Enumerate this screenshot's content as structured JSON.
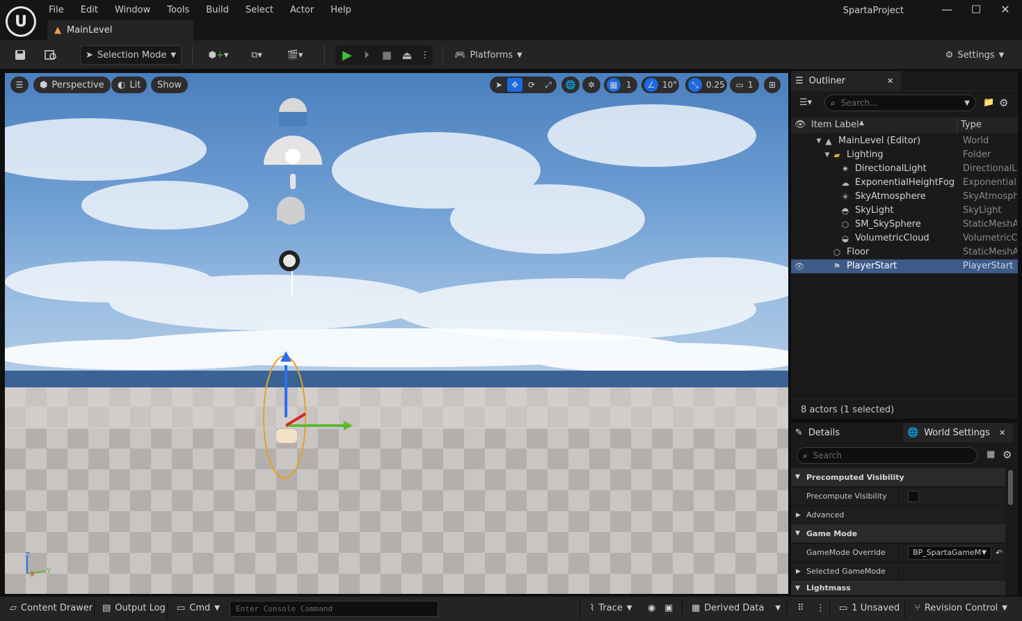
{
  "title_bar": {
    "menu": [
      "File",
      "Edit",
      "Window",
      "Tools",
      "Build",
      "Select",
      "Actor",
      "Help"
    ],
    "project_name": "SpartaProject",
    "level_tab": "MainLevel"
  },
  "toolbar": {
    "selection_mode": "Selection Mode",
    "platforms": "Platforms",
    "settings": "Settings"
  },
  "viewport": {
    "perspective": "Perspective",
    "lit": "Lit",
    "show": "Show",
    "grid_snap": "1",
    "rotation_snap": "10°",
    "scale_snap": "0.25",
    "camera_speed": "1",
    "axis_labels": {
      "z": "Z",
      "x": "X",
      "y": "Y"
    }
  },
  "outliner": {
    "tab": "Outliner",
    "search_placeholder": "Search...",
    "columns": {
      "label": "Item Label",
      "type": "Type"
    },
    "rows": [
      {
        "label": "MainLevel (Editor)",
        "type": "World"
      },
      {
        "label": "Lighting",
        "type": "Folder"
      },
      {
        "label": "DirectionalLight",
        "type": "DirectionalLig"
      },
      {
        "label": "ExponentialHeightFog",
        "type": "ExponentialHe"
      },
      {
        "label": "SkyAtmosphere",
        "type": "SkyAtmosphe"
      },
      {
        "label": "SkyLight",
        "type": "SkyLight"
      },
      {
        "label": "SM_SkySphere",
        "type": "StaticMeshAc"
      },
      {
        "label": "VolumetricCloud",
        "type": "VolumetricClc"
      },
      {
        "label": "Floor",
        "type": "StaticMeshAc"
      },
      {
        "label": "PlayerStart",
        "type": "PlayerStart"
      }
    ],
    "footer": "8 actors (1 selected)"
  },
  "details": {
    "tab_details": "Details",
    "tab_world": "World Settings",
    "search_placeholder": "Search",
    "sections": {
      "precomputed_visibility": "Precomputed Visibility",
      "precompute_visibility": "Precompute Visibility",
      "advanced": "Advanced",
      "game_mode": "Game Mode",
      "gamemode_override": "GameMode Override",
      "gamemode_override_value": "BP_SpartaGameM",
      "selected_gamemode": "Selected GameMode",
      "lightmass": "Lightmass"
    }
  },
  "status_bar": {
    "content_drawer": "Content Drawer",
    "output_log": "Output Log",
    "cmd": "Cmd",
    "console_placeholder": "Enter Console Command",
    "trace": "Trace",
    "derived_data": "Derived Data",
    "unsaved": "1 Unsaved",
    "revision_control": "Revision Control"
  }
}
